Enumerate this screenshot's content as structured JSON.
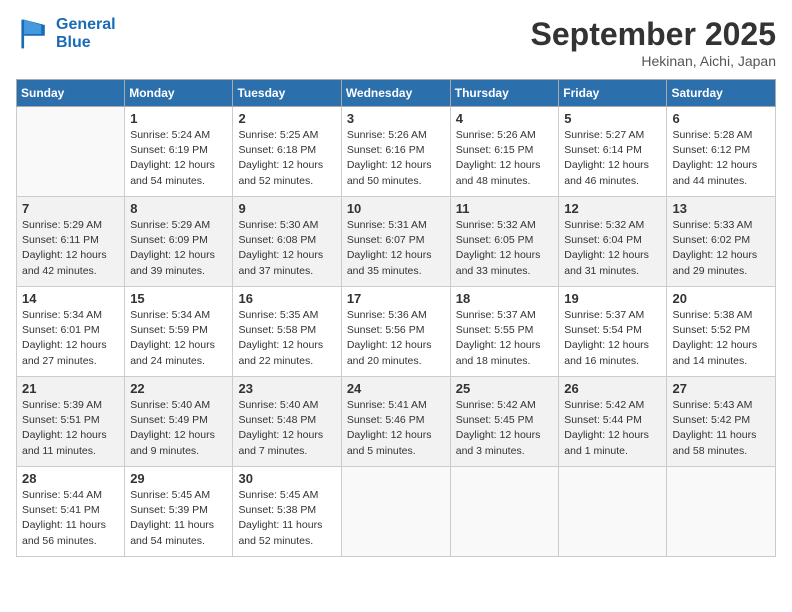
{
  "header": {
    "logo_line1": "General",
    "logo_line2": "Blue",
    "month": "September 2025",
    "location": "Hekinan, Aichi, Japan"
  },
  "weekdays": [
    "Sunday",
    "Monday",
    "Tuesday",
    "Wednesday",
    "Thursday",
    "Friday",
    "Saturday"
  ],
  "weeks": [
    [
      {
        "num": "",
        "info": ""
      },
      {
        "num": "1",
        "info": "Sunrise: 5:24 AM\nSunset: 6:19 PM\nDaylight: 12 hours\nand 54 minutes."
      },
      {
        "num": "2",
        "info": "Sunrise: 5:25 AM\nSunset: 6:18 PM\nDaylight: 12 hours\nand 52 minutes."
      },
      {
        "num": "3",
        "info": "Sunrise: 5:26 AM\nSunset: 6:16 PM\nDaylight: 12 hours\nand 50 minutes."
      },
      {
        "num": "4",
        "info": "Sunrise: 5:26 AM\nSunset: 6:15 PM\nDaylight: 12 hours\nand 48 minutes."
      },
      {
        "num": "5",
        "info": "Sunrise: 5:27 AM\nSunset: 6:14 PM\nDaylight: 12 hours\nand 46 minutes."
      },
      {
        "num": "6",
        "info": "Sunrise: 5:28 AM\nSunset: 6:12 PM\nDaylight: 12 hours\nand 44 minutes."
      }
    ],
    [
      {
        "num": "7",
        "info": "Sunrise: 5:29 AM\nSunset: 6:11 PM\nDaylight: 12 hours\nand 42 minutes."
      },
      {
        "num": "8",
        "info": "Sunrise: 5:29 AM\nSunset: 6:09 PM\nDaylight: 12 hours\nand 39 minutes."
      },
      {
        "num": "9",
        "info": "Sunrise: 5:30 AM\nSunset: 6:08 PM\nDaylight: 12 hours\nand 37 minutes."
      },
      {
        "num": "10",
        "info": "Sunrise: 5:31 AM\nSunset: 6:07 PM\nDaylight: 12 hours\nand 35 minutes."
      },
      {
        "num": "11",
        "info": "Sunrise: 5:32 AM\nSunset: 6:05 PM\nDaylight: 12 hours\nand 33 minutes."
      },
      {
        "num": "12",
        "info": "Sunrise: 5:32 AM\nSunset: 6:04 PM\nDaylight: 12 hours\nand 31 minutes."
      },
      {
        "num": "13",
        "info": "Sunrise: 5:33 AM\nSunset: 6:02 PM\nDaylight: 12 hours\nand 29 minutes."
      }
    ],
    [
      {
        "num": "14",
        "info": "Sunrise: 5:34 AM\nSunset: 6:01 PM\nDaylight: 12 hours\nand 27 minutes."
      },
      {
        "num": "15",
        "info": "Sunrise: 5:34 AM\nSunset: 5:59 PM\nDaylight: 12 hours\nand 24 minutes."
      },
      {
        "num": "16",
        "info": "Sunrise: 5:35 AM\nSunset: 5:58 PM\nDaylight: 12 hours\nand 22 minutes."
      },
      {
        "num": "17",
        "info": "Sunrise: 5:36 AM\nSunset: 5:56 PM\nDaylight: 12 hours\nand 20 minutes."
      },
      {
        "num": "18",
        "info": "Sunrise: 5:37 AM\nSunset: 5:55 PM\nDaylight: 12 hours\nand 18 minutes."
      },
      {
        "num": "19",
        "info": "Sunrise: 5:37 AM\nSunset: 5:54 PM\nDaylight: 12 hours\nand 16 minutes."
      },
      {
        "num": "20",
        "info": "Sunrise: 5:38 AM\nSunset: 5:52 PM\nDaylight: 12 hours\nand 14 minutes."
      }
    ],
    [
      {
        "num": "21",
        "info": "Sunrise: 5:39 AM\nSunset: 5:51 PM\nDaylight: 12 hours\nand 11 minutes."
      },
      {
        "num": "22",
        "info": "Sunrise: 5:40 AM\nSunset: 5:49 PM\nDaylight: 12 hours\nand 9 minutes."
      },
      {
        "num": "23",
        "info": "Sunrise: 5:40 AM\nSunset: 5:48 PM\nDaylight: 12 hours\nand 7 minutes."
      },
      {
        "num": "24",
        "info": "Sunrise: 5:41 AM\nSunset: 5:46 PM\nDaylight: 12 hours\nand 5 minutes."
      },
      {
        "num": "25",
        "info": "Sunrise: 5:42 AM\nSunset: 5:45 PM\nDaylight: 12 hours\nand 3 minutes."
      },
      {
        "num": "26",
        "info": "Sunrise: 5:42 AM\nSunset: 5:44 PM\nDaylight: 12 hours\nand 1 minute."
      },
      {
        "num": "27",
        "info": "Sunrise: 5:43 AM\nSunset: 5:42 PM\nDaylight: 11 hours\nand 58 minutes."
      }
    ],
    [
      {
        "num": "28",
        "info": "Sunrise: 5:44 AM\nSunset: 5:41 PM\nDaylight: 11 hours\nand 56 minutes."
      },
      {
        "num": "29",
        "info": "Sunrise: 5:45 AM\nSunset: 5:39 PM\nDaylight: 11 hours\nand 54 minutes."
      },
      {
        "num": "30",
        "info": "Sunrise: 5:45 AM\nSunset: 5:38 PM\nDaylight: 11 hours\nand 52 minutes."
      },
      {
        "num": "",
        "info": ""
      },
      {
        "num": "",
        "info": ""
      },
      {
        "num": "",
        "info": ""
      },
      {
        "num": "",
        "info": ""
      }
    ]
  ]
}
